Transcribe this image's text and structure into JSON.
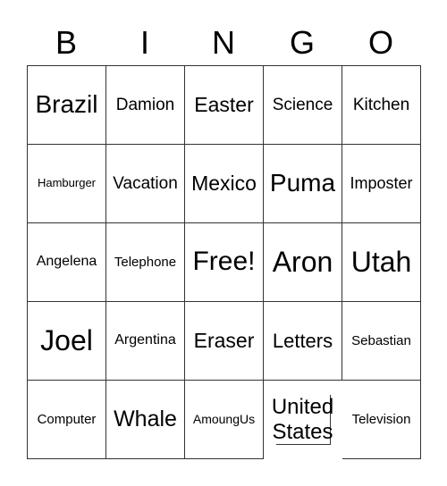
{
  "header": [
    "B",
    "I",
    "N",
    "G",
    "O"
  ],
  "cells": [
    [
      "Brazil",
      "Damion",
      "Easter",
      "Science",
      "Kitchen"
    ],
    [
      "Hamburger",
      "Vacation",
      "Mexico",
      "Puma",
      "Imposter"
    ],
    [
      "Angelena",
      "Telephone",
      "Free!",
      "Aron",
      "Utah"
    ],
    [
      "Joel",
      "Argentina",
      "Eraser",
      "Letters",
      "Sebastian"
    ],
    [
      "Computer",
      "Whale",
      "AmoungUs",
      "United States",
      "Television"
    ]
  ]
}
